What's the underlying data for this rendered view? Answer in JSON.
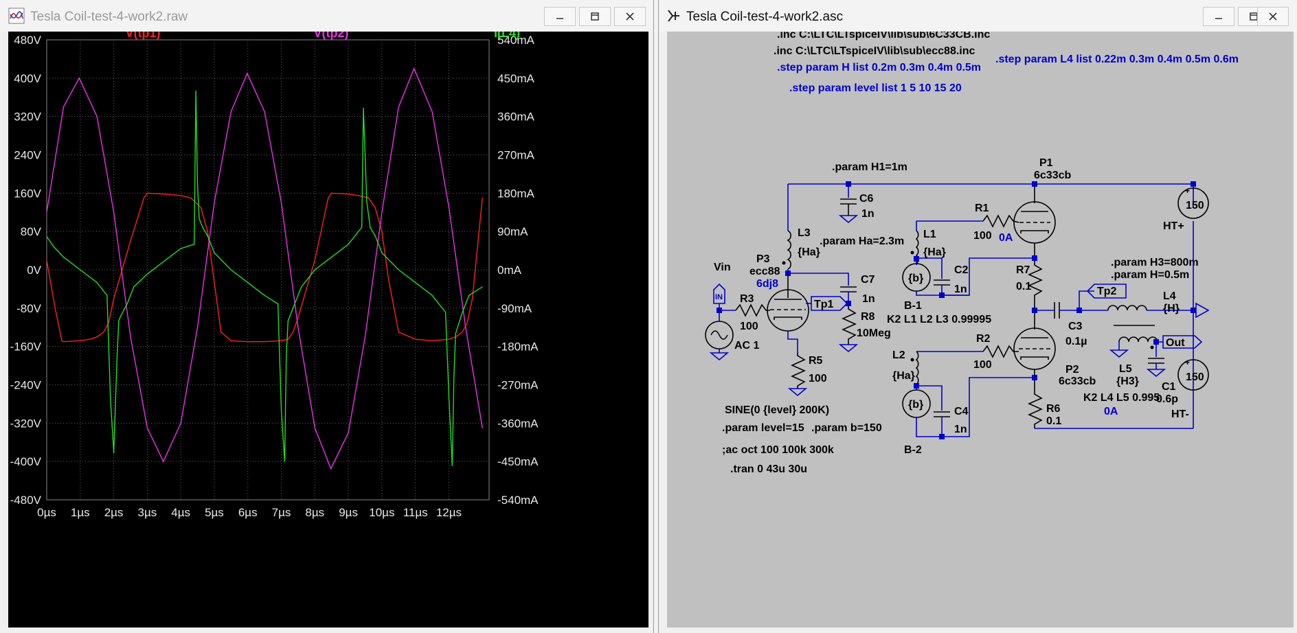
{
  "waveform_window": {
    "title": "Tesla Coil-test-4-work2.raw",
    "controls": {
      "minimize": "minimize-icon",
      "maximize": "maximize-icon",
      "close": "close-icon"
    }
  },
  "schematic_window": {
    "title": "Tesla Coil-test-4-work2.asc",
    "controls": {
      "minimize": "minimize-icon",
      "maximize": "maximize-icon",
      "close": "close-icon"
    }
  },
  "chart_data": {
    "type": "line",
    "background": "#000000",
    "grid": true,
    "xlim": [
      0,
      13.2
    ],
    "x_ticks": [
      "0µs",
      "1µs",
      "2µs",
      "3µs",
      "4µs",
      "5µs",
      "6µs",
      "7µs",
      "8µs",
      "9µs",
      "10µs",
      "11µs",
      "12µs"
    ],
    "left_axis": {
      "ylim": [
        -480,
        480
      ],
      "ticks": [
        "480V",
        "400V",
        "320V",
        "240V",
        "160V",
        "80V",
        "0V",
        "-80V",
        "-160V",
        "-240V",
        "-320V",
        "-400V",
        "-480V"
      ]
    },
    "right_axis": {
      "ylim": [
        -540,
        540
      ],
      "ticks": [
        "540mA",
        "450mA",
        "360mA",
        "270mA",
        "180mA",
        "90mA",
        "0mA",
        "-90mA",
        "-180mA",
        "-270mA",
        "-360mA",
        "-450mA",
        "-540mA"
      ]
    },
    "series": [
      {
        "name": "V(tp1)",
        "color": "#ff2020",
        "axis": "left",
        "x": [
          0,
          0.25,
          0.45,
          0.5,
          1.0,
          1.3,
          1.5,
          1.7,
          1.85,
          2.0,
          2.5,
          2.9,
          3.0,
          3.5,
          4.0,
          4.3,
          4.6,
          4.8,
          4.95,
          5.2,
          5.5,
          6.0,
          6.5,
          7.0,
          7.2,
          7.35,
          7.5,
          8.0,
          8.4,
          8.5,
          9.0,
          9.3,
          9.6,
          9.8,
          10.0,
          10.2,
          10.5,
          11.0,
          11.5,
          12.0,
          12.2,
          12.4,
          12.55,
          12.7,
          13.0
        ],
        "y": [
          20,
          -80,
          -148,
          -150,
          -148,
          -145,
          -140,
          -130,
          -110,
          -60,
          60,
          150,
          160,
          158,
          155,
          150,
          130,
          80,
          0,
          -130,
          -148,
          -150,
          -150,
          -148,
          -145,
          -130,
          -100,
          20,
          150,
          160,
          158,
          155,
          150,
          130,
          80,
          -20,
          -130,
          -145,
          -148,
          -145,
          -140,
          -130,
          -110,
          -60,
          150
        ]
      },
      {
        "name": "V(tp2)",
        "color": "#ee30ee",
        "axis": "left",
        "x": [
          0,
          0.5,
          0.97,
          1.5,
          2.0,
          2.5,
          3.0,
          3.48,
          4.0,
          4.5,
          5.0,
          5.5,
          5.98,
          6.5,
          7.0,
          7.5,
          8.0,
          8.48,
          9.0,
          9.5,
          10.0,
          10.5,
          10.96,
          11.5,
          12.0,
          12.5,
          13.0
        ],
        "y": [
          120,
          340,
          400,
          320,
          120,
          -140,
          -330,
          -400,
          -320,
          -120,
          140,
          330,
          410,
          330,
          140,
          -120,
          -330,
          -415,
          -340,
          -140,
          120,
          340,
          420,
          330,
          130,
          -120,
          -330
        ]
      },
      {
        "name": "I(L4)",
        "color": "#20e020",
        "axis": "right",
        "x": [
          0,
          0.2,
          0.5,
          1.0,
          1.5,
          1.8,
          1.9,
          2.0,
          2.1,
          2.15,
          2.2,
          2.4,
          2.6,
          3.0,
          3.5,
          4.0,
          4.4,
          4.45,
          4.5,
          4.55,
          4.65,
          4.8,
          5.0,
          5.5,
          6.0,
          6.5,
          6.9,
          7.0,
          7.1,
          7.15,
          7.2,
          7.4,
          7.6,
          8.0,
          8.5,
          9.0,
          9.4,
          9.45,
          9.55,
          9.65,
          9.8,
          10.0,
          10.5,
          11.0,
          11.5,
          11.9,
          12.0,
          12.1,
          12.15,
          12.2,
          12.4,
          12.6,
          13.0
        ],
        "y": [
          78,
          55,
          30,
          0,
          -30,
          -60,
          -300,
          -430,
          -200,
          -120,
          -110,
          -80,
          -40,
          -10,
          20,
          50,
          60,
          420,
          200,
          120,
          100,
          80,
          40,
          0,
          -30,
          -60,
          -80,
          -330,
          -450,
          -200,
          -120,
          -80,
          -40,
          0,
          30,
          60,
          100,
          380,
          160,
          100,
          80,
          40,
          0,
          -30,
          -60,
          -100,
          -300,
          -460,
          -250,
          -150,
          -100,
          -60,
          -40
        ]
      }
    ]
  },
  "schematic": {
    "directives": [
      ".inc C:\\LTC\\LTspiceIV\\lib\\sub\\6C33CB.inc",
      ".inc C:\\LTC\\LTspiceIV\\lib\\sub\\ecc88.inc",
      ".step param H list 0.2m 0.3m 0.4m 0.5m",
      ".step param L4 list  0.22m 0.3m 0.4m 0.5m 0.6m",
      ".step param level list 1 5 10 15 20"
    ],
    "labels": {
      "param_h1": ".param H1=1m",
      "p1": "P1",
      "p1_model": "6c33cb",
      "c6": "C6",
      "c6_val": "1n",
      "r1": "R1",
      "r1_val": "100",
      "r1_current": "0A",
      "l3": "L3",
      "l3_val": "{Ha}",
      "param_ha": ".param Ha=2.3m",
      "l1": "L1",
      "l1_val": "{Ha}",
      "ht_plus": "HT+",
      "ht_plus_val": "150",
      "param_h3": ".param H3=800m",
      "param_h": ".param H=0.5m",
      "p3": "P3",
      "p3_model": "ecc88",
      "p3_ref": "6dj8",
      "vin": "Vin",
      "c7": "C7",
      "c7_val": "1n",
      "b_val_1": "{b}",
      "c2": "C2",
      "c2_val": "1n",
      "r7": "R7",
      "r7_val": "0.1",
      "tp2": "Tp2",
      "tp1": "Tp1",
      "r3": "R3",
      "r3_val": "100",
      "l4": "L4",
      "l4_val": "{H}",
      "b1": "B-1",
      "k2_1": "K2 L1 L2 L3 0.99995",
      "c3": "C3",
      "c3_val": "0.1µ",
      "r8": "R8",
      "r8_val": "10Meg",
      "ac": "AC 1",
      "r2": "R2",
      "r2_val": "100",
      "out": "Out",
      "l5": "L5",
      "l5_val": "{H3}",
      "l2": "L2",
      "l2_val": "{Ha}",
      "r5": "R5",
      "r5_val": "100",
      "p2": "P2",
      "p2_model": "6c33cb",
      "c1": "C1",
      "c1_val": "0.6p",
      "ht_minus_val": "150",
      "b_val_2": "{b}",
      "k2_2": "K2 L4 L5  0.995",
      "current_2": "0A",
      "ht_minus": "HT-",
      "sine": "SINE(0 {level} 200K)",
      "c4": "C4",
      "c4_val": "1n",
      "r6": "R6",
      "r6_val": "0.1",
      "param_level": ".param level=15",
      "param_b": ".param b=150",
      "ac_oct": ";ac oct 100 100k 300k",
      "tran": ".tran 0 43u 30u",
      "b2": "B-2"
    }
  }
}
